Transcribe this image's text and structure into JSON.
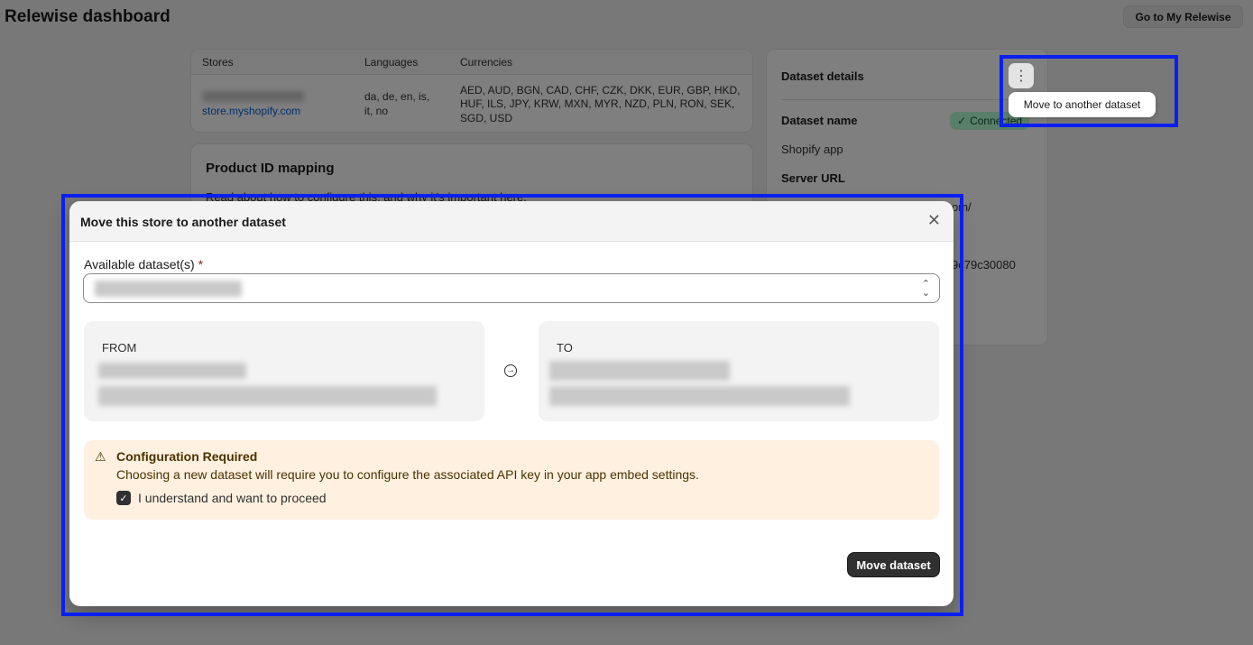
{
  "page": {
    "title": "Relewise dashboard",
    "top_button": "Go to My Relewise"
  },
  "stores_table": {
    "headers": [
      "Stores",
      "Languages",
      "Currencies"
    ],
    "row": {
      "store_link": "store.myshopify.com",
      "languages_line1": "da, de, en, is,",
      "languages_line2": "it, no",
      "currencies_line1": "AED, AUD, BGN, CAD, CHF, CZK, DKK, EUR, GBP, HKD,",
      "currencies_line2": "HUF, ILS, JPY, KRW, MXN, MYR, NZD, PLN, RON, SEK,",
      "currencies_line3": "SGD, USD"
    }
  },
  "mapping": {
    "title": "Product ID mapping",
    "text": "Read about how to configure this, and why it's important here."
  },
  "dataset_details": {
    "title": "Dataset details",
    "name_label": "Dataset name",
    "status": "Connected",
    "name_value": "Shopify app",
    "server_label": "Server URL",
    "server_value_fragment": "om/",
    "id_fragment": "9c79c30080"
  },
  "popover": {
    "label": "Move to another dataset"
  },
  "modal": {
    "title": "Move this store to another dataset",
    "field_label": "Available dataset(s)",
    "required_mark": "*",
    "from_label": "FROM",
    "to_label": "TO",
    "banner_title": "Configuration Required",
    "banner_text": "Choosing a new dataset will require you to configure the associated API key in your app embed settings.",
    "checkbox_label": "I understand and want to proceed",
    "submit_label": "Move dataset"
  },
  "colors": {
    "highlight": "#0a1ff0",
    "banner_bg": "#fff0e0",
    "badge_bg": "#b4fed2",
    "primary": "#303030"
  }
}
